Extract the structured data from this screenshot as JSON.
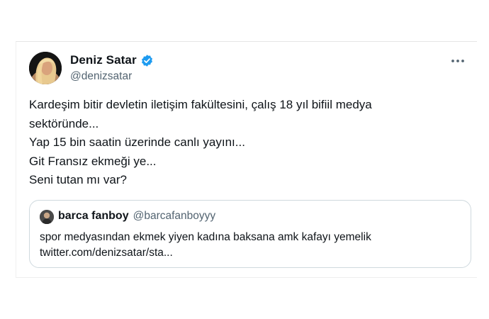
{
  "tweet": {
    "author_name": "Deniz Satar",
    "author_handle": "@denizsatar",
    "verified_icon": "verified-badge-icon",
    "more_icon": "more-options-icon",
    "accent_color": "#1d9bf0",
    "lines": [
      "Kardeşim bitir devletin iletişim fakültesini, çalış 18 yıl bifiil medya",
      "sektöründe...",
      "Yap 15 bin saatin üzerinde canlı yayını...",
      "Git Fransız ekmeği ye...",
      "Seni tutan mı var?"
    ]
  },
  "quoted_tweet": {
    "author_name": "barca fanboy",
    "author_handle": "@barcafanboyyy",
    "text": "spor medyasından ekmek yiyen kadına baksana amk kafayı yemelik",
    "link": "twitter.com/denizsatar/sta..."
  }
}
